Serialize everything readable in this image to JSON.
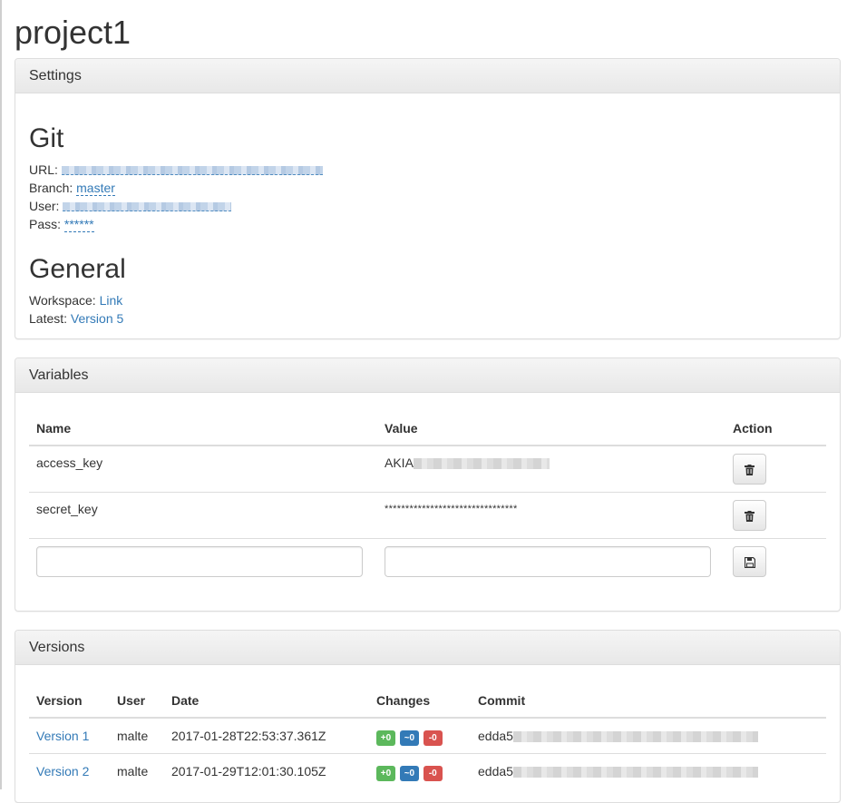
{
  "project": {
    "title": "project1"
  },
  "settings": {
    "heading": "Settings",
    "git": {
      "title": "Git",
      "url_label": "URL:",
      "branch_label": "Branch:",
      "branch_value": "master",
      "user_label": "User:",
      "pass_label": "Pass:",
      "pass_value": "******"
    },
    "general": {
      "title": "General",
      "workspace_label": "Workspace:",
      "workspace_link": "Link",
      "latest_label": "Latest:",
      "latest_link": "Version 5"
    }
  },
  "variables": {
    "heading": "Variables",
    "columns": {
      "name": "Name",
      "value": "Value",
      "action": "Action"
    },
    "rows": [
      {
        "name": "access_key",
        "value_prefix": "AKIA"
      },
      {
        "name": "secret_key",
        "value_prefix": "********************************"
      }
    ]
  },
  "versions": {
    "heading": "Versions",
    "columns": {
      "version": "Version",
      "user": "User",
      "date": "Date",
      "changes": "Changes",
      "commit": "Commit"
    },
    "rows": [
      {
        "version": "Version 1",
        "user": "malte",
        "date": "2017-01-28T22:53:37.361Z",
        "added": "+0",
        "modified": "~0",
        "deleted": "-0",
        "commit_prefix": "edda5"
      },
      {
        "version": "Version 2",
        "user": "malte",
        "date": "2017-01-29T12:01:30.105Z",
        "added": "+0",
        "modified": "~0",
        "deleted": "-0",
        "commit_prefix": "edda5"
      }
    ]
  },
  "colors": {
    "link": "#337ab7",
    "added": "#5cb85c",
    "modified": "#337ab7",
    "deleted": "#d9534f"
  },
  "icons": {
    "delete": "trash-icon",
    "save": "floppy-disk-icon"
  }
}
